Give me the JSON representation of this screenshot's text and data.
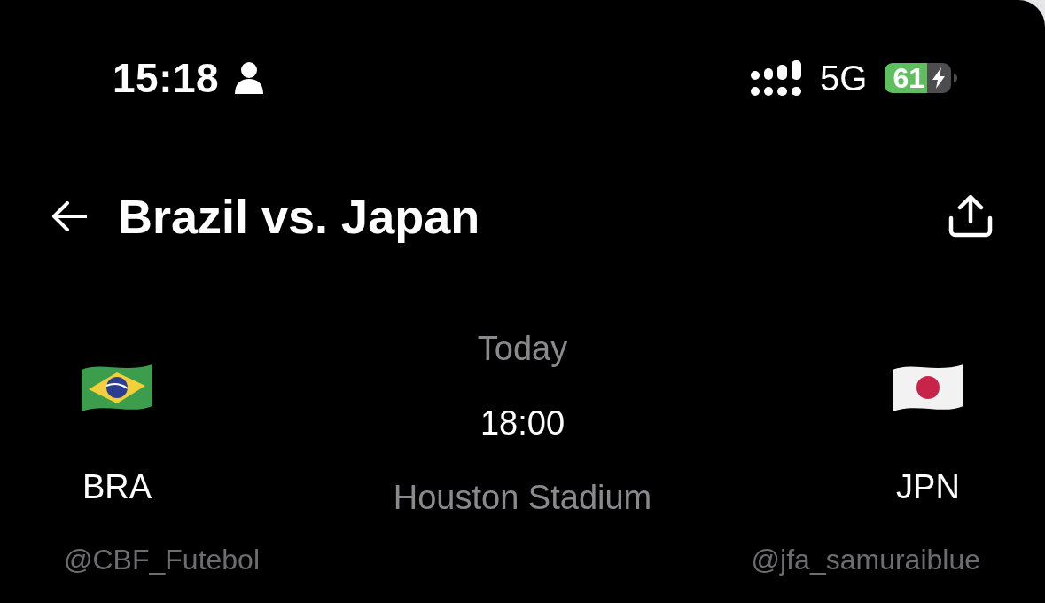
{
  "status_bar": {
    "time": "15:18",
    "network": "5G",
    "battery": "61"
  },
  "header": {
    "title": "Brazil vs. Japan"
  },
  "match": {
    "day": "Today",
    "time": "18:00",
    "venue": "Houston Stadium",
    "teams": [
      {
        "kind": "brazil",
        "code": "BRA",
        "handle": "@CBF_Futebol"
      },
      {
        "kind": "japan",
        "code": "JPN",
        "handle": "@jfa_samuraiblue"
      }
    ]
  }
}
